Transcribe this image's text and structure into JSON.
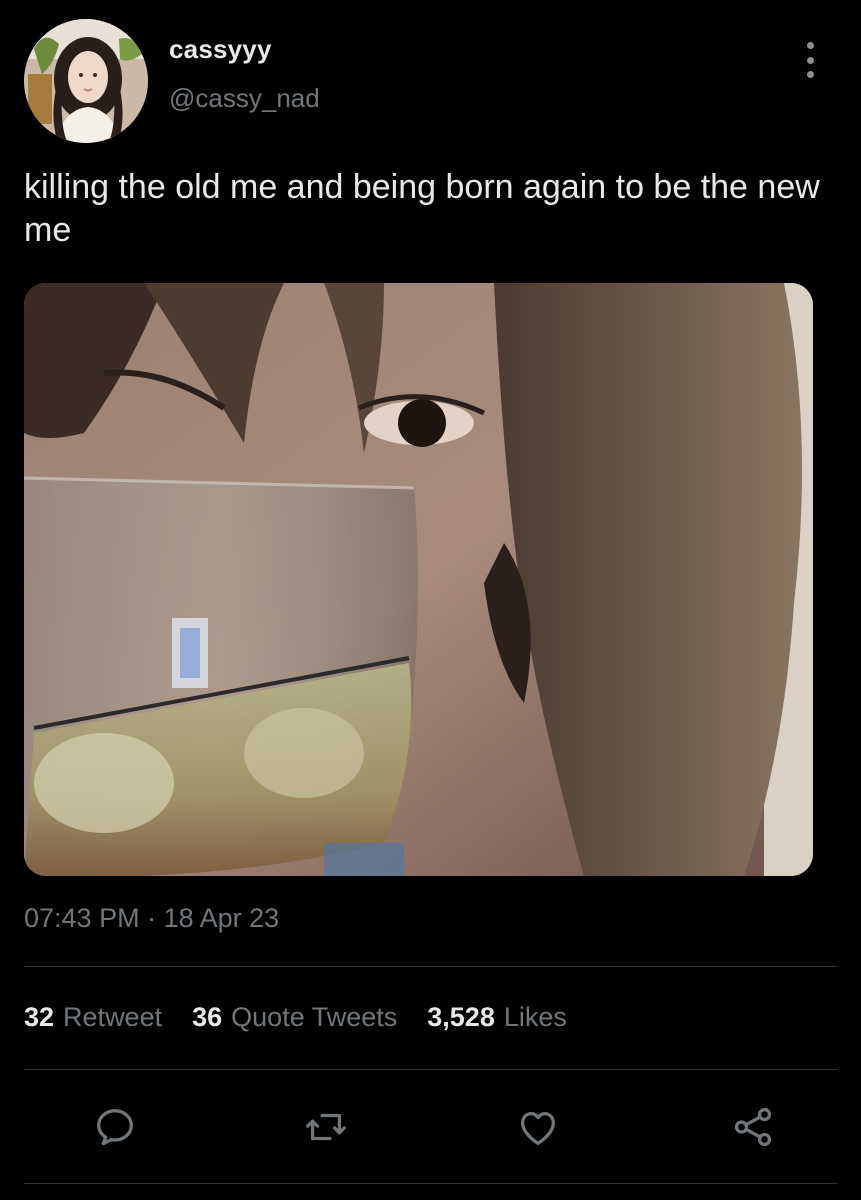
{
  "tweet": {
    "display_name": "cassyyy",
    "handle": "@cassy_nad",
    "text": "killing the old me and being born again to be the new me",
    "timestamp": "07:43 PM · 18 Apr 23"
  },
  "stats": [
    {
      "count": "32",
      "label": "Retweet"
    },
    {
      "count": "36",
      "label": "Quote Tweets"
    },
    {
      "count": "3,528",
      "label": "Likes"
    }
  ],
  "actions": [
    {
      "icon": "reply-icon"
    },
    {
      "icon": "retweet-icon"
    },
    {
      "icon": "like-icon"
    },
    {
      "icon": "share-icon"
    }
  ],
  "colors": {
    "background": "#000000",
    "primary_text": "#e7e9ea",
    "secondary_text": "#71767b",
    "divider": "#2f3336"
  }
}
